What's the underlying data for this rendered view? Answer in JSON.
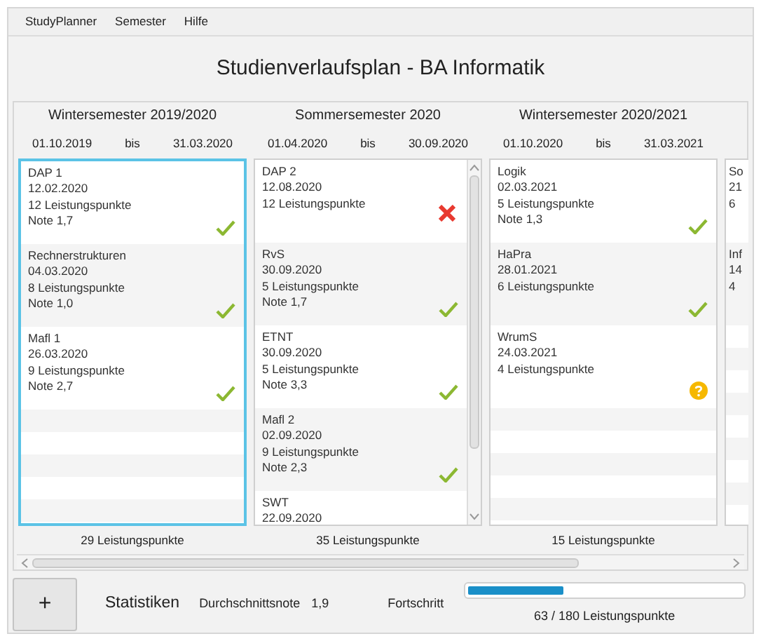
{
  "menu": [
    "StudyPlanner",
    "Semester",
    "Hilfe"
  ],
  "title": "Studienverlaufsplan - BA Informatik",
  "semesters": [
    {
      "title": "Wintersemester 2019/2020",
      "start": "01.10.2019",
      "sep": "bis",
      "end": "31.03.2020",
      "selected": true,
      "scrollable": false,
      "cut": false,
      "total": "29 Leistungspunkte",
      "modules": [
        {
          "name": "DAP 1",
          "date": "12.02.2020",
          "points": "12 Leistungspunkte",
          "grade": "Note 1,7",
          "kind": "passed"
        },
        {
          "name": "Rechnerstrukturen",
          "date": "04.03.2020",
          "points": "8 Leistungspunkte",
          "grade": "Note 1,0",
          "kind": "passed"
        },
        {
          "name": "Mafl 1",
          "date": "26.03.2020",
          "points": "9 Leistungspunkte",
          "grade": "Note 2,7",
          "kind": "passed"
        }
      ]
    },
    {
      "title": "Sommersemester 2020",
      "start": "01.04.2020",
      "sep": "bis",
      "end": "30.09.2020",
      "selected": false,
      "scrollable": true,
      "cut": false,
      "total": "35 Leistungspunkte",
      "modules": [
        {
          "name": "DAP 2",
          "date": "12.08.2020",
          "points": "12 Leistungspunkte",
          "kind": "failed"
        },
        {
          "name": "RvS",
          "date": "30.09.2020",
          "points": "5 Leistungspunkte",
          "grade": "Note 1,7",
          "kind": "passed"
        },
        {
          "name": "ETNT",
          "date": "30.09.2020",
          "points": "5 Leistungspunkte",
          "grade": "Note 3,3",
          "kind": "passed"
        },
        {
          "name": "Mafl 2",
          "date": "02.09.2020",
          "points": "9 Leistungspunkte",
          "grade": "Note 2,3",
          "kind": "passed"
        },
        {
          "name": "SWT",
          "date": "22.09.2020"
        }
      ]
    },
    {
      "title": "Wintersemester 2020/2021",
      "start": "01.10.2020",
      "sep": "bis",
      "end": "31.03.2021",
      "selected": false,
      "scrollable": false,
      "cut": false,
      "total": "15 Leistungspunkte",
      "modules": [
        {
          "name": "Logik",
          "date": "02.03.2021",
          "points": "5 Leistungspunkte",
          "grade": "Note 1,3",
          "kind": "passed"
        },
        {
          "name": "HaPra",
          "date": "28.01.2021",
          "points": "6 Leistungspunkte",
          "kind": "passed"
        },
        {
          "name": "WrumS",
          "date": "24.03.2021",
          "points": "4 Leistungspunkte",
          "kind": "pending"
        }
      ]
    },
    {
      "selected": false,
      "scrollable": false,
      "cut": true,
      "modules": [
        {
          "name": "So",
          "date": "21",
          "points": "6"
        },
        {
          "name": "Inf",
          "date": "14",
          "points": "4"
        }
      ]
    }
  ],
  "add_button": "+",
  "stats": {
    "heading": "Statistiken",
    "average_label": "Durchschnittsnote",
    "average": "1,9",
    "progress_label": "Fortschritt",
    "level": 0.35,
    "progress_text": "63 / 180 Leistungspunkte"
  }
}
